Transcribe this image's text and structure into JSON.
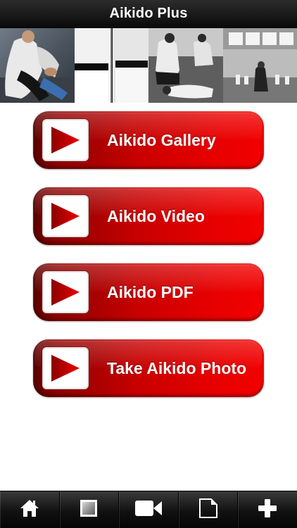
{
  "app": {
    "title": "Aikido Plus"
  },
  "banner": {
    "photos": [
      "aikido-photo-1",
      "aikido-photo-2",
      "aikido-photo-3",
      "aikido-photo-4"
    ]
  },
  "menu": {
    "items": [
      {
        "label": "Aikido Gallery",
        "icon": "play-icon"
      },
      {
        "label": "Aikido Video",
        "icon": "play-icon"
      },
      {
        "label": "Aikido PDF",
        "icon": "play-icon"
      },
      {
        "label": "Take Aikido Photo",
        "icon": "play-icon"
      }
    ],
    "accent_color": "#e00000"
  },
  "tab_bar": {
    "tabs": [
      {
        "icon": "home-icon"
      },
      {
        "icon": "gallery-icon"
      },
      {
        "icon": "video-camera-icon"
      },
      {
        "icon": "document-icon"
      },
      {
        "icon": "plus-icon"
      }
    ]
  }
}
